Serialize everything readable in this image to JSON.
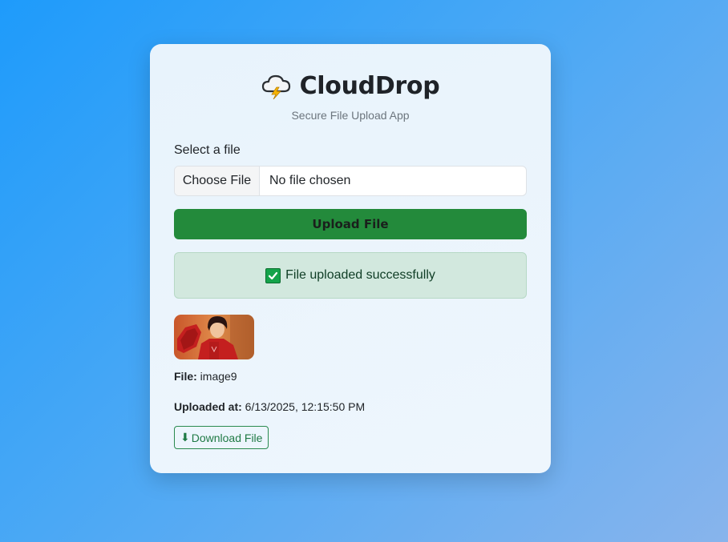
{
  "app": {
    "title": "CloudDrop",
    "subtitle": "Secure File Upload App",
    "icon": "cloud-lightning-icon"
  },
  "form": {
    "field_label": "Select a file",
    "choose_file_label": "Choose File",
    "file_status": "No file chosen",
    "upload_button_label": "Upload File"
  },
  "alert": {
    "icon": "check-icon",
    "message": "File uploaded successfully",
    "background": "#d2e8de"
  },
  "result": {
    "thumbnail_icon": "uploaded-image-thumbnail",
    "file_label": "File:",
    "file_name": "image9",
    "uploaded_label": "Uploaded at:",
    "uploaded_at": "6/13/2025, 12:15:50 PM",
    "download_arrow": "⬇",
    "download_label": "Download File"
  },
  "colors": {
    "primary_button": "#238a3b",
    "download_accent": "#1f7a45",
    "background_start": "#1e9bfb",
    "background_end": "#88b4ec"
  }
}
